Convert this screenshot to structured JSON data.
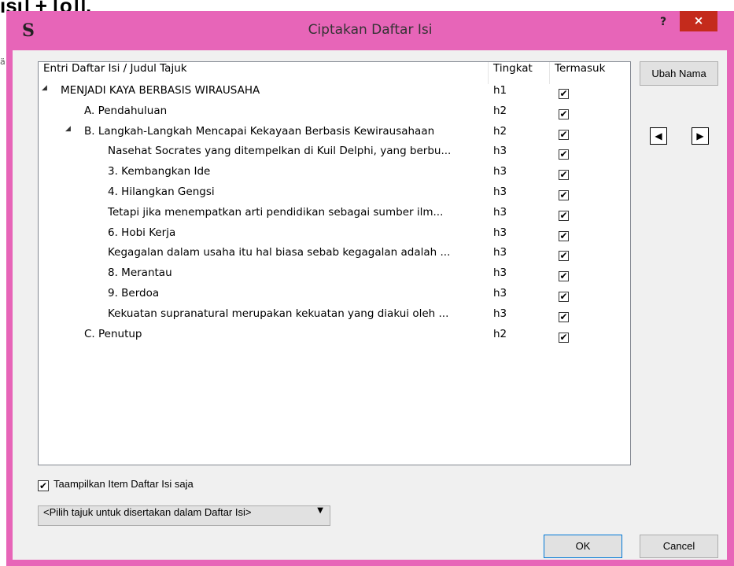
{
  "background": {
    "title_fragment": "isi] + [o]].",
    "side_glyph": "ä"
  },
  "dialog": {
    "title": "Ciptakan Daftar Isi",
    "app_icon": "S",
    "help": "?",
    "close": "×"
  },
  "table": {
    "headers": [
      "Entri Daftar Isi / Judul Tajuk",
      "Tingkat",
      "Termasuk"
    ],
    "rows": [
      {
        "text": "MENJADI KAYA BERBASIS WIRAUSAHA",
        "level": "h1",
        "included": true,
        "expanded": true
      },
      {
        "text": "A. Pendahuluan",
        "level": "h2",
        "included": true
      },
      {
        "text": "B. Langkah-Langkah Mencapai Kekayaan Berbasis Kewirausahaan",
        "level": "h2",
        "included": true,
        "expanded": true
      },
      {
        "text": "Nasehat Socrates yang ditempelkan di Kuil Delphi, yang berbu...",
        "level": "h3",
        "included": true
      },
      {
        "text": "3. Kembangkan Ide",
        "level": "h3",
        "included": true
      },
      {
        "text": "4. Hilangkan Gengsi",
        "level": "h3",
        "included": true
      },
      {
        "text": "Tetapi jika menempatkan arti pendidikan sebagai sumber ilm...",
        "level": "h3",
        "included": true
      },
      {
        "text": "6. Hobi Kerja",
        "level": "h3",
        "included": true
      },
      {
        "text": "Kegagalan dalam usaha itu hal biasa sebab kegagalan adalah ...",
        "level": "h3",
        "included": true
      },
      {
        "text": "8. Merantau",
        "level": "h3",
        "included": true
      },
      {
        "text": "9. Berdoa",
        "level": "h3",
        "included": true
      },
      {
        "text": "Kekuatan supranatural merupakan kekuatan yang diakui oleh ...",
        "level": "h3",
        "included": true
      },
      {
        "text": "C. Penutup",
        "level": "h2",
        "included": true
      }
    ]
  },
  "controls": {
    "rename": "Ubah Nama",
    "promote_icon": "◀",
    "demote_icon": "▶",
    "show_only_label": "Taampilkan Item Daftar Isi saja",
    "show_only_checked": true,
    "select_value": "<Pilih tajuk untuk disertakan dalam Daftar Isi>",
    "select_arrow": "▼",
    "ok": "OK",
    "cancel": "Cancel"
  },
  "colors": {
    "titlebar": "#e765b8",
    "close": "#c42b1c"
  }
}
